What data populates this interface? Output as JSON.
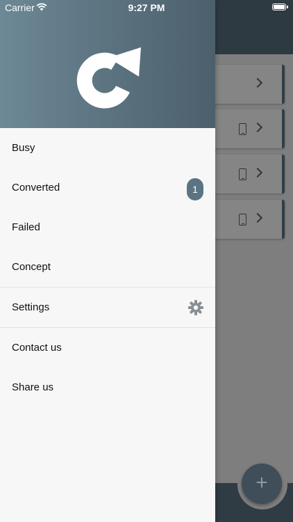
{
  "status_bar": {
    "carrier": "Carrier",
    "time": "9:27 PM"
  },
  "drawer": {
    "logo_icon": "refresh-arrow-logo",
    "colors": {
      "header": "#5a717e",
      "badge": "#5b7483"
    },
    "items": [
      {
        "label": "Busy"
      },
      {
        "label": "Converted",
        "badge": "1"
      },
      {
        "label": "Failed"
      },
      {
        "label": "Concept"
      },
      {
        "label": "Settings",
        "icon": "gear-icon"
      },
      {
        "label": "Contact us"
      },
      {
        "label": "Share us"
      }
    ]
  },
  "background": {
    "cards": [
      {
        "icons": [
          "chevron-right-icon"
        ]
      },
      {
        "icons": [
          "phone-icon",
          "chevron-right-icon"
        ]
      },
      {
        "icons": [
          "phone-icon",
          "chevron-right-icon"
        ]
      },
      {
        "icons": [
          "phone-icon",
          "chevron-right-icon"
        ]
      }
    ],
    "fab_label": "+"
  }
}
